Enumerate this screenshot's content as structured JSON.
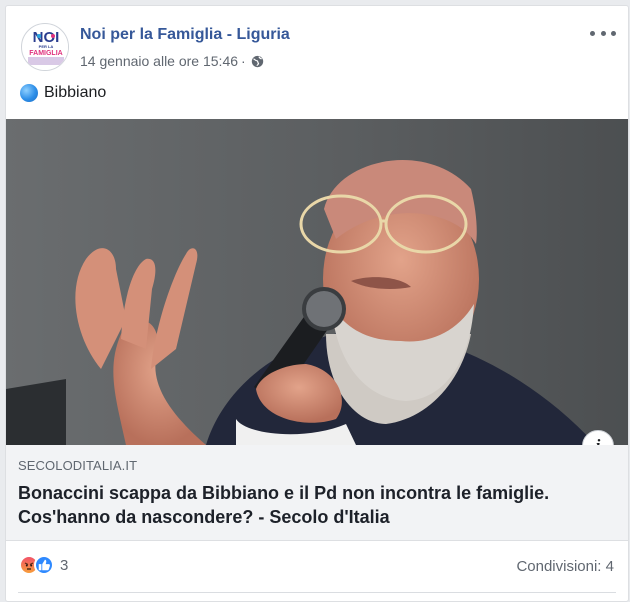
{
  "post": {
    "page_name": "Noi per la Famiglia - Liguria",
    "timestamp": "14 gennaio alle ore 15:46",
    "meta_separator": "·",
    "privacy_icon": "globe-icon",
    "more_icon": "more-options-icon",
    "text": "Bibbiano",
    "text_emoji": "blue-circle-icon"
  },
  "avatar": {
    "line1": "NOI",
    "line2": "PER LA",
    "line3": "FAMIGLIA"
  },
  "link": {
    "domain": "SECOLODITALIA.IT",
    "title": "Bonaccini scappa da Bibbiano e il Pd non incontra le famiglie. Cos'hanno da nascondere? - Secolo d'Italia",
    "info_label": "i"
  },
  "footer": {
    "reaction_icons": [
      "angry-reaction-icon",
      "like-reaction-icon"
    ],
    "reaction_count": "3",
    "shares": "Condivisioni: 4"
  },
  "colors": {
    "link_blue": "#365899",
    "meta_grey": "#606770",
    "like_blue": "#2e89ff"
  }
}
